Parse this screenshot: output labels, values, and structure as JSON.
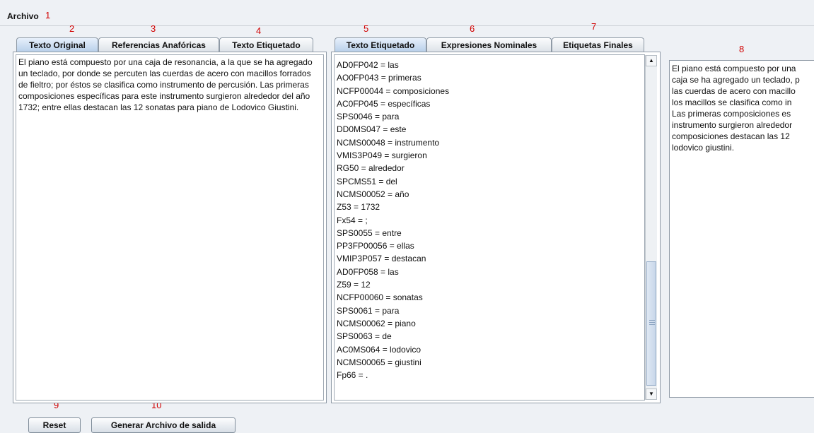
{
  "menu": {
    "archivo": "Archivo"
  },
  "markers": [
    "1",
    "2",
    "3",
    "4",
    "5",
    "6",
    "7",
    "8",
    "9",
    "10"
  ],
  "left_tabs": [
    "Texto Original",
    "Referencias Anafóricas",
    "Texto Etiquetado"
  ],
  "middle_tabs": [
    "Texto Etiquetado",
    "Expresiones Nominales",
    "Etiquetas Finales"
  ],
  "original_text": "El piano está compuesto por una caja de resonancia, a la que se ha agregado un teclado, por donde se percuten las cuerdas de acero con macillos forrados de fieltro; por éstos se clasifica como instrumento de percusión. Las primeras composiciones específicas para este instrumento surgieron alrededor del año 1732; entre ellas destacan las 12 sonatas para piano de Lodovico Giustini.",
  "tagged_lines": [
    "AD0FP042 = las",
    "AO0FP043 = primeras",
    "NCFP00044 = composiciones",
    "AC0FP045 = específicas",
    "SPS0046 = para",
    "DD0MS047 = este",
    "NCMS00048 = instrumento",
    "VMIS3P049 = surgieron",
    "RG50 = alrededor",
    "SPCMS51 = del",
    "NCMS00052 = año",
    "Z53 = 1732",
    "Fx54 = ;",
    "SPS0055 = entre",
    "PP3FP00056 = ellas",
    "VMIP3P057 = destacan",
    "AD0FP058 = las",
    "Z59 = 12",
    "NCFP00060 = sonatas",
    "SPS0061 = para",
    "NCMS00062 = piano",
    "SPS0063 = de",
    "AC0MS064 = lodovico",
    "NCMS00065 = giustini",
    "Fp66 = ."
  ],
  "right_lines": [
    "El piano está compuesto por una",
    "caja se ha agregado un teclado, p",
    "las cuerdas de acero con macillo",
    "los macillos se clasifica como in",
    "Las primeras composiciones es",
    "instrumento surgieron alrededor",
    "composiciones destacan las 12",
    "lodovico giustini."
  ],
  "buttons": {
    "reset": "Reset",
    "generar": "Generar Archivo de salida"
  }
}
